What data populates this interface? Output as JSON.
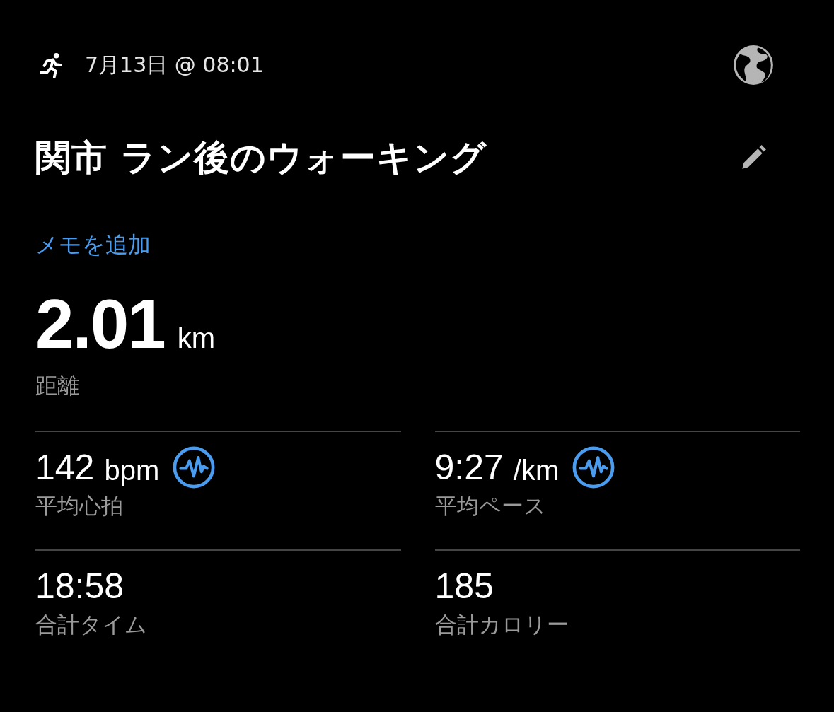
{
  "header": {
    "date": "7月13日 @ 08:01"
  },
  "title": "関市 ラン後のウォーキング",
  "add_note_link": "メモを追加",
  "distance": {
    "value": "2.01",
    "unit": "km",
    "label": "距離"
  },
  "stats": [
    {
      "value": "142",
      "unit": "bpm",
      "label": "平均心拍",
      "chart_icon": true
    },
    {
      "value": "9:27",
      "unit": "/km",
      "label": "平均ペース",
      "chart_icon": true
    },
    {
      "value": "18:58",
      "label": "合計タイム",
      "chart_icon": false
    },
    {
      "value": "185",
      "label": "合計カロリー",
      "chart_icon": false
    }
  ]
}
